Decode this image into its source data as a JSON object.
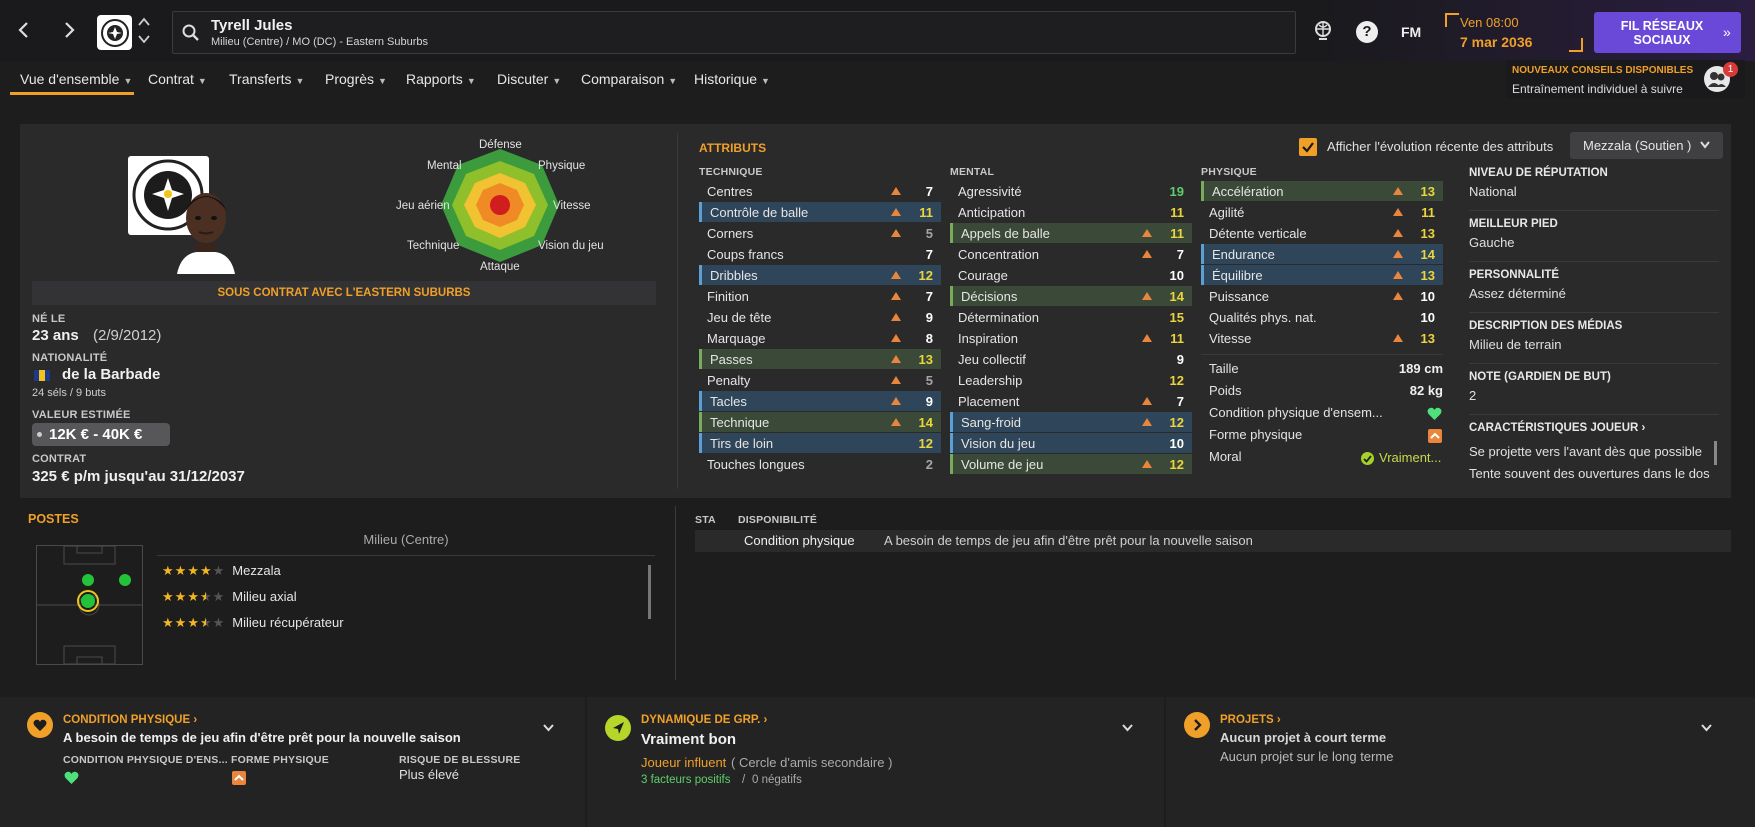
{
  "header": {
    "player_name": "Tyrell Jules",
    "player_sub": "Milieu (Centre) / MO (DC) - Eastern Suburbs",
    "date_day": "Ven 08:00",
    "date_full": "7 mar 2036",
    "social_button": "FIL RÉSEAUX SOCIAUX",
    "fm_label": "FM",
    "notif_title": "NOUVEAUX CONSEILS DISPONIBLES",
    "notif_text": "Entraînement individuel à suivre",
    "notif_count": "1"
  },
  "tabs": [
    {
      "label": "Vue d'ensemble"
    },
    {
      "label": "Contrat"
    },
    {
      "label": "Transferts"
    },
    {
      "label": "Progrès"
    },
    {
      "label": "Rapports"
    },
    {
      "label": "Discuter"
    },
    {
      "label": "Comparaison"
    },
    {
      "label": "Historique"
    }
  ],
  "profile": {
    "radar_labels": {
      "top": "Défense",
      "tr": "Physique",
      "r": "Vitesse",
      "br": "Vision du jeu",
      "bottom": "Attaque",
      "bl": "Technique",
      "l": "Jeu aérien",
      "tl": "Mental"
    },
    "contract_banner": "SOUS CONTRAT AVEC L'EASTERN SUBURBS",
    "born_label": "NÉ LE",
    "age": "23 ans",
    "dob": "(2/9/2012)",
    "nationality_label": "NATIONALITÉ",
    "nationality": "de la Barbade",
    "caps": "24 séls / 9 buts",
    "value_label": "VALEUR ESTIMÉE",
    "value": "12K € - 40K €",
    "contract_label": "CONTRAT",
    "contract": "325 € p/m jusqu'au 31/12/2037"
  },
  "attributes": {
    "title": "ATTRIBUTS",
    "checkbox_label": "Afficher l'évolution récente des attributs",
    "role_select": "Mezzala (Soutien )",
    "technique_header": "TECHNIQUE",
    "mental_header": "MENTAL",
    "physique_header": "PHYSIQUE",
    "technique": [
      {
        "name": "Centres",
        "val": "7",
        "trend": true,
        "hl": "",
        "col": "white"
      },
      {
        "name": "Contrôle de balle",
        "val": "11",
        "trend": true,
        "hl": "blue",
        "col": "yellow"
      },
      {
        "name": "Corners",
        "val": "5",
        "trend": true,
        "hl": "",
        "col": "grey"
      },
      {
        "name": "Coups francs",
        "val": "7",
        "trend": false,
        "hl": "",
        "col": "white"
      },
      {
        "name": "Dribbles",
        "val": "12",
        "trend": true,
        "hl": "blue",
        "col": "yellow"
      },
      {
        "name": "Finition",
        "val": "7",
        "trend": true,
        "hl": "",
        "col": "white"
      },
      {
        "name": "Jeu de tête",
        "val": "9",
        "trend": true,
        "hl": "",
        "col": "white"
      },
      {
        "name": "Marquage",
        "val": "8",
        "trend": true,
        "hl": "",
        "col": "white"
      },
      {
        "name": "Passes",
        "val": "13",
        "trend": true,
        "hl": "green",
        "col": "yellow"
      },
      {
        "name": "Penalty",
        "val": "5",
        "trend": true,
        "hl": "",
        "col": "grey"
      },
      {
        "name": "Tacles",
        "val": "9",
        "trend": true,
        "hl": "blue",
        "col": "white"
      },
      {
        "name": "Technique",
        "val": "14",
        "trend": true,
        "hl": "green",
        "col": "yellow"
      },
      {
        "name": "Tirs de loin",
        "val": "12",
        "trend": false,
        "hl": "blue",
        "col": "yellow"
      },
      {
        "name": "Touches longues",
        "val": "2",
        "trend": false,
        "hl": "",
        "col": "grey"
      }
    ],
    "mental": [
      {
        "name": "Agressivité",
        "val": "19",
        "trend": false,
        "hl": "",
        "col": "green"
      },
      {
        "name": "Anticipation",
        "val": "11",
        "trend": false,
        "hl": "",
        "col": "yellow"
      },
      {
        "name": "Appels de balle",
        "val": "11",
        "trend": true,
        "hl": "green",
        "col": "yellow"
      },
      {
        "name": "Concentration",
        "val": "7",
        "trend": true,
        "hl": "",
        "col": "white"
      },
      {
        "name": "Courage",
        "val": "10",
        "trend": false,
        "hl": "",
        "col": "white"
      },
      {
        "name": "Décisions",
        "val": "14",
        "trend": true,
        "hl": "green",
        "col": "yellow"
      },
      {
        "name": "Détermination",
        "val": "15",
        "trend": false,
        "hl": "",
        "col": "yellow"
      },
      {
        "name": "Inspiration",
        "val": "11",
        "trend": true,
        "hl": "",
        "col": "yellow"
      },
      {
        "name": "Jeu collectif",
        "val": "9",
        "trend": false,
        "hl": "",
        "col": "white"
      },
      {
        "name": "Leadership",
        "val": "12",
        "trend": false,
        "hl": "",
        "col": "yellow"
      },
      {
        "name": "Placement",
        "val": "7",
        "trend": true,
        "hl": "",
        "col": "white"
      },
      {
        "name": "Sang-froid",
        "val": "12",
        "trend": true,
        "hl": "blue",
        "col": "yellow"
      },
      {
        "name": "Vision du jeu",
        "val": "10",
        "trend": false,
        "hl": "blue",
        "col": "white"
      },
      {
        "name": "Volume de jeu",
        "val": "12",
        "trend": true,
        "hl": "green",
        "col": "yellow"
      }
    ],
    "physique": [
      {
        "name": "Accélération",
        "val": "13",
        "trend": true,
        "hl": "green",
        "col": "yellow"
      },
      {
        "name": "Agilité",
        "val": "11",
        "trend": true,
        "hl": "",
        "col": "yellow"
      },
      {
        "name": "Détente verticale",
        "val": "13",
        "trend": true,
        "hl": "",
        "col": "yellow"
      },
      {
        "name": "Endurance",
        "val": "14",
        "trend": true,
        "hl": "blue",
        "col": "yellow"
      },
      {
        "name": "Équilibre",
        "val": "13",
        "trend": true,
        "hl": "blue",
        "col": "yellow"
      },
      {
        "name": "Puissance",
        "val": "10",
        "trend": true,
        "hl": "",
        "col": "white"
      },
      {
        "name": "Qualités phys. nat.",
        "val": "10",
        "trend": false,
        "hl": "",
        "col": "white"
      },
      {
        "name": "Vitesse",
        "val": "13",
        "trend": true,
        "hl": "",
        "col": "yellow"
      }
    ],
    "height_label": "Taille",
    "height": "189 cm",
    "weight_label": "Poids",
    "weight": "82 kg",
    "condition_label": "Condition physique d'ensem...",
    "form_label": "Forme physique",
    "morale_label": "Moral",
    "morale": "Vraiment..."
  },
  "info": {
    "rep_h": "NIVEAU DE RÉPUTATION",
    "rep_v": "National",
    "foot_h": "MEILLEUR PIED",
    "foot_v": "Gauche",
    "pers_h": "PERSONNALITÉ",
    "pers_v": "Assez déterminé",
    "media_h": "DESCRIPTION DES MÉDIAS",
    "media_v": "Milieu de terrain",
    "gk_h": "NOTE (GARDIEN DE BUT)",
    "gk_v": "2",
    "traits_h": "CARACTÉRISTIQUES JOUEUR",
    "trait1": "Se projette vers l'avant dès que possible",
    "trait2": "Tente souvent des ouvertures dans le dos"
  },
  "positions": {
    "title": "POSTES",
    "main": "Milieu (Centre)",
    "roles": [
      {
        "name": "Mezzala",
        "stars": 4
      },
      {
        "name": "Milieu axial",
        "stars": 3.5
      },
      {
        "name": "Milieu récupérateur",
        "stars": 3.5
      }
    ]
  },
  "availability": {
    "sta_h": "STA",
    "dispo_h": "DISPONIBILITÉ",
    "item": "Condition physique",
    "desc": "A besoin de temps de jeu afin d'être prêt pour la nouvelle saison"
  },
  "bottom": {
    "cond_title": "CONDITION PHYSIQUE",
    "cond_text": "A besoin de temps de jeu afin d'être prêt pour la nouvelle saison",
    "cond_sub1": "CONDITION PHYSIQUE D'ENS...",
    "cond_sub2": "FORME PHYSIQUE",
    "cond_sub3": "RISQUE DE BLESSURE",
    "cond_risk": "Plus élevé",
    "dyn_title": "DYNAMIQUE DE GRP.",
    "dyn_text": "Vraiment bon",
    "dyn_role": "Joueur influent",
    "dyn_circle": "( Cercle d'amis secondaire )",
    "dyn_pos": "3 facteurs positifs",
    "dyn_sep": "/",
    "dyn_neg": "0 négatifs",
    "proj_title": "PROJETS",
    "proj_short": "Aucun projet à court terme",
    "proj_long": "Aucun projet sur le long terme"
  },
  "colors": {
    "accent": "#f0a029",
    "purple": "#6b49d8",
    "green": "#4ee07a"
  }
}
